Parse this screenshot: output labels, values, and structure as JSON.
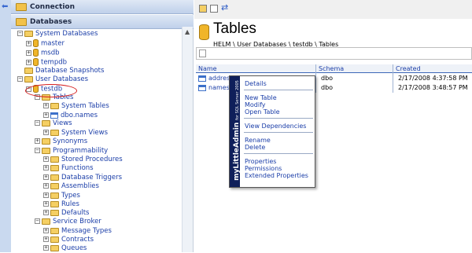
{
  "tree": {
    "connection_label": "Connection",
    "databases_label": "Databases",
    "items": [
      {
        "label": "System Databases",
        "pm": "−",
        "icon": "folder"
      },
      {
        "label": "master",
        "pm": "+",
        "icon": "db"
      },
      {
        "label": "msdb",
        "pm": "+",
        "icon": "db"
      },
      {
        "label": "tempdb",
        "pm": "+",
        "icon": "db"
      },
      {
        "label": "Database Snapshots",
        "pm": "",
        "icon": "folder"
      },
      {
        "label": "User Databases",
        "pm": "−",
        "icon": "folder"
      },
      {
        "label": "testdb",
        "pm": "−",
        "icon": "db"
      },
      {
        "label": "Tables",
        "pm": "−",
        "icon": "folder"
      },
      {
        "label": "System Tables",
        "pm": "+",
        "icon": "folder"
      },
      {
        "label": "dbo.names",
        "pm": "+",
        "icon": "table"
      },
      {
        "label": "Views",
        "pm": "−",
        "icon": "folder"
      },
      {
        "label": "System Views",
        "pm": "+",
        "icon": "folder"
      },
      {
        "label": "Synonyms",
        "pm": "+",
        "icon": "folder"
      },
      {
        "label": "Programmability",
        "pm": "−",
        "icon": "folder"
      },
      {
        "label": "Stored Procedures",
        "pm": "+",
        "icon": "folder"
      },
      {
        "label": "Functions",
        "pm": "+",
        "icon": "folder"
      },
      {
        "label": "Database Triggers",
        "pm": "+",
        "icon": "folder"
      },
      {
        "label": "Assemblies",
        "pm": "+",
        "icon": "folder"
      },
      {
        "label": "Types",
        "pm": "+",
        "icon": "folder"
      },
      {
        "label": "Rules",
        "pm": "+",
        "icon": "folder"
      },
      {
        "label": "Defaults",
        "pm": "+",
        "icon": "folder"
      },
      {
        "label": "Service Broker",
        "pm": "−",
        "icon": "folder"
      },
      {
        "label": "Message Types",
        "pm": "+",
        "icon": "folder"
      },
      {
        "label": "Contracts",
        "pm": "+",
        "icon": "folder"
      },
      {
        "label": "Queues",
        "pm": "+",
        "icon": "folder"
      }
    ]
  },
  "main": {
    "title": "Tables",
    "breadcrumb": "HELM \\ User Databases \\ testdb \\ Tables",
    "columns": [
      "Name",
      "Schema",
      "Created"
    ],
    "rows": [
      {
        "name": "addresses",
        "schema": "dbo",
        "created": "2/17/2008 4:37:58 PM"
      },
      {
        "name": "names",
        "schema": "dbo",
        "created": "2/17/2008 3:48:57 PM"
      }
    ]
  },
  "context_menu": {
    "brand": "myLittleAdmin",
    "brand_sub": "for SQL Server 2005",
    "groups": [
      [
        "Details"
      ],
      [
        "New Table",
        "Modify",
        "Open Table"
      ],
      [
        "View Dependencies"
      ],
      [
        "Rename",
        "Delete"
      ],
      [
        "Properties",
        "Permissions",
        "Extended Properties"
      ]
    ]
  },
  "colors": {
    "accent": "#1b3ea8",
    "brand_band": "#0f1f5a",
    "highlight_circle": "#d61f1f"
  }
}
